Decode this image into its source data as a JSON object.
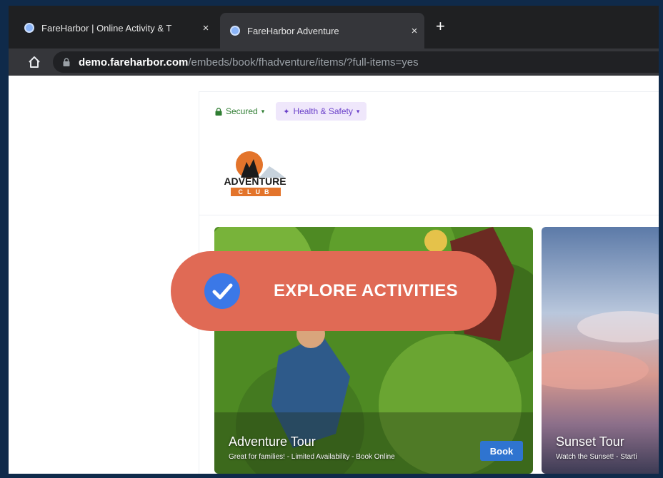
{
  "browser": {
    "tabs": [
      {
        "title": "FareHarbor | Online Activity & T",
        "active": false,
        "icon": "globe-favicon"
      },
      {
        "title": "FareHarbor Adventure",
        "active": true,
        "icon": "globe-favicon"
      }
    ],
    "close_glyph": "×",
    "new_tab_glyph": "+",
    "url_host": "demo.fareharbor.com",
    "url_path": "/embeds/book/fhadventure/items/?full-items=yes"
  },
  "header": {
    "secured_label": "Secured",
    "secured_caret": "▾",
    "health_label": "Health & Safety",
    "health_caret": "▾",
    "logo_line1": "ADVENTURE",
    "logo_line2": "CLUB"
  },
  "items": [
    {
      "title": "Adventure Tour",
      "subtitle": "Great for families! - Limited Availability - Book Online",
      "button": "Book"
    },
    {
      "title": "Sunset Tour",
      "subtitle": "Watch the Sunset! - Starti"
    }
  ],
  "callout": {
    "label": "EXPLORE ACTIVITIES",
    "icon": "check-circle-icon"
  },
  "colors": {
    "callout": "#e06a55",
    "check": "#3b78e7",
    "book_button": "#2f74d0",
    "frame": "#0f2a4a"
  }
}
